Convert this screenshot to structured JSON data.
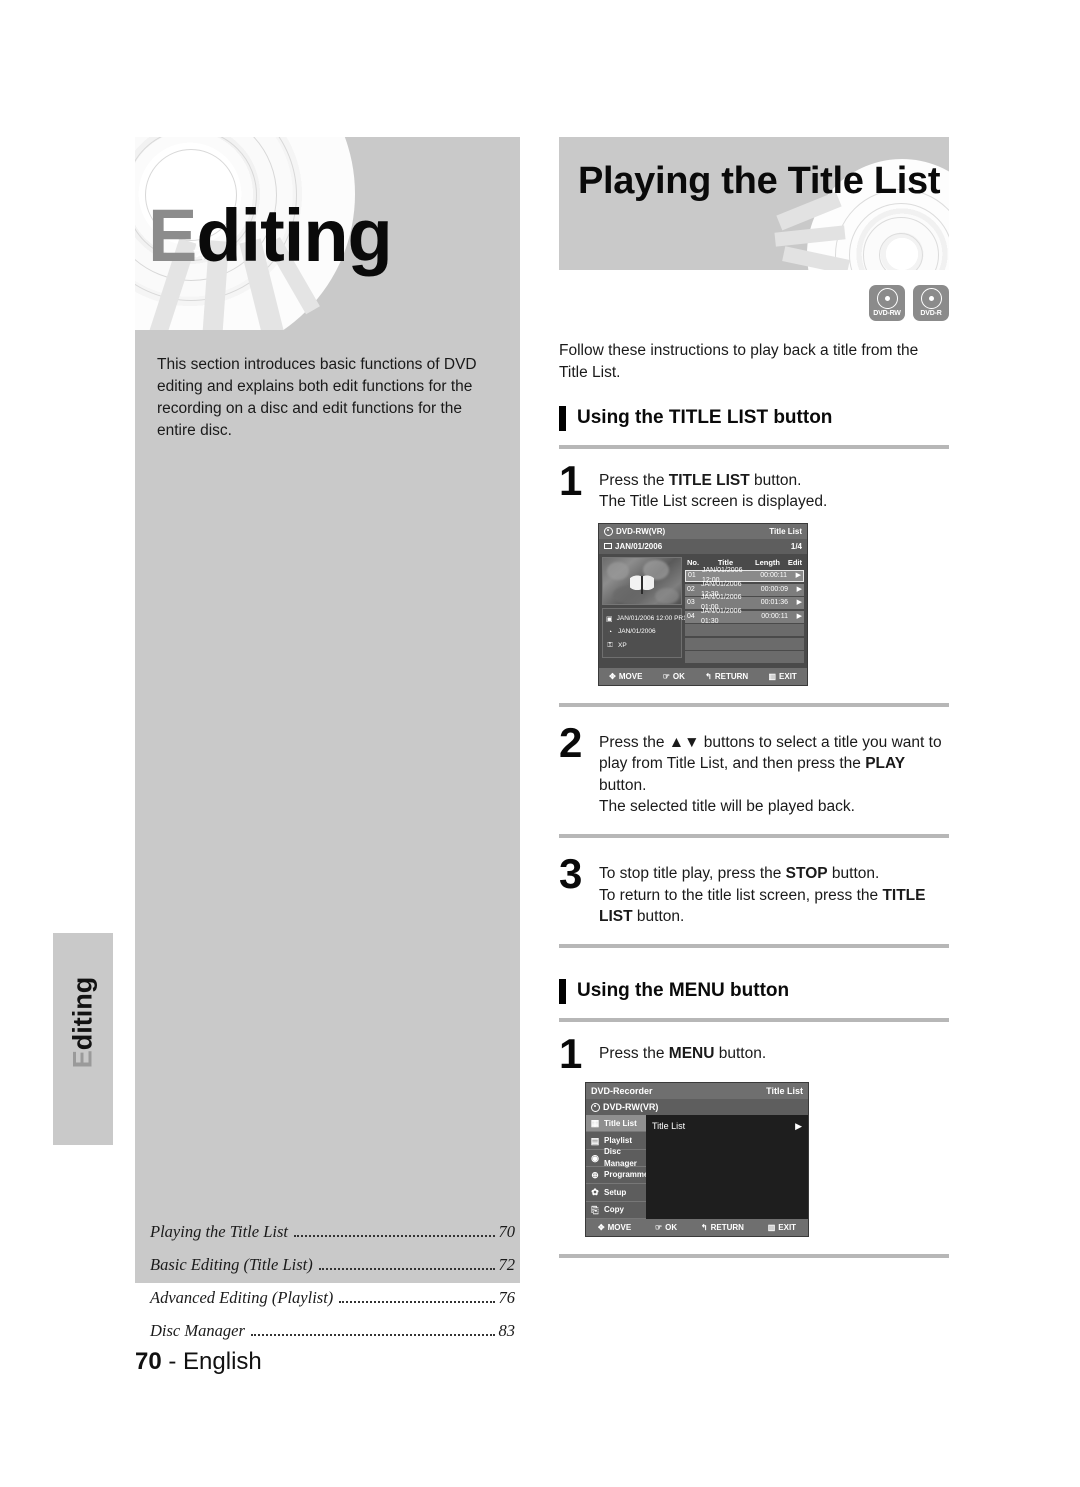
{
  "left": {
    "chapter_title_first": "E",
    "chapter_title_rest": "diting",
    "intro_paragraph": "This section introduces basic functions of DVD editing and explains both edit functions for the recording on a disc and edit functions for the entire disc.",
    "side_tab_first": "E",
    "side_tab_rest": "diting",
    "toc": [
      {
        "title": "Playing the Title List",
        "page": "70"
      },
      {
        "title": "Basic Editing (Title List)",
        "page": "72"
      },
      {
        "title": "Advanced Editing (Playlist)",
        "page": "76"
      },
      {
        "title": "Disc Manager",
        "page": "83"
      }
    ],
    "footer_page": "70",
    "footer_sep": "-",
    "footer_language": "English"
  },
  "right": {
    "section_title": "Playing the Title List",
    "badges": [
      {
        "label": "DVD-RW"
      },
      {
        "label": "DVD-R"
      }
    ],
    "lede": "Follow these instructions to play back a title from the Title List.",
    "subsection_1": {
      "heading": "Using the TITLE LIST button",
      "steps": [
        {
          "number": "1",
          "lines": [
            [
              {
                "t": "Press the ",
                "b": false
              },
              {
                "t": "TITLE LIST",
                "b": true
              },
              {
                "t": " button.",
                "b": false
              }
            ],
            [
              {
                "t": "The Title List screen is displayed.",
                "b": false
              }
            ]
          ]
        },
        {
          "number": "2",
          "lines": [
            [
              {
                "t": "Press the ▲▼ buttons to select a title you want to play from Title List, and then press the ",
                "b": false
              },
              {
                "t": "PLAY",
                "b": true
              },
              {
                "t": " button.",
                "b": false
              }
            ],
            [
              {
                "t": "The selected title will be played back.",
                "b": false
              }
            ]
          ]
        },
        {
          "number": "3",
          "lines": [
            [
              {
                "t": "To stop title play, press the ",
                "b": false
              },
              {
                "t": "STOP",
                "b": true
              },
              {
                "t": " button.",
                "b": false
              }
            ],
            [
              {
                "t": "To return to the title list screen, press the ",
                "b": false
              },
              {
                "t": "TITLE LIST",
                "b": true
              },
              {
                "t": " button.",
                "b": false
              }
            ]
          ]
        }
      ]
    },
    "subsection_2": {
      "heading": "Using the MENU button",
      "steps": [
        {
          "number": "1",
          "lines": [
            [
              {
                "t": "Press the ",
                "b": false
              },
              {
                "t": "MENU",
                "b": true
              },
              {
                "t": " button.",
                "b": false
              }
            ]
          ]
        }
      ]
    }
  },
  "osd_title_list": {
    "disc_type": "DVD-RW(VR)",
    "screen_name": "Title List",
    "disc_label": "JAN/01/2006",
    "page_indicator": "1/4",
    "columns": [
      "No.",
      "Title",
      "Length",
      "Edit"
    ],
    "rows": [
      {
        "no": "01",
        "title": "JAN/01/2006 12:00",
        "length": "00:00:11",
        "edit": "▶",
        "selected": true
      },
      {
        "no": "02",
        "title": "JAN/01/2006 12:30",
        "length": "00:00:09",
        "edit": "▶",
        "selected": false
      },
      {
        "no": "03",
        "title": "JAN/01/2006 01:00",
        "length": "00:01:36",
        "edit": "▶",
        "selected": false
      },
      {
        "no": "04",
        "title": "JAN/01/2006 01:30",
        "length": "00:00:11",
        "edit": "▶",
        "selected": false
      }
    ],
    "meta": [
      {
        "icon": "frame-icon",
        "glyph": "▣",
        "text": "JAN/01/2006 12:00 PR1"
      },
      {
        "icon": "clock-icon",
        "glyph": "◔",
        "text": "JAN/01/2006"
      },
      {
        "icon": "lock-icon",
        "glyph": "⚿",
        "text": "XP"
      }
    ],
    "footer": [
      {
        "icon": "dpad-icon",
        "glyph": "✥",
        "label": "MOVE"
      },
      {
        "icon": "ok-icon",
        "glyph": "☞",
        "label": "OK"
      },
      {
        "icon": "return-icon",
        "glyph": "↰",
        "label": "RETURN"
      },
      {
        "icon": "exit-icon",
        "glyph": "▥",
        "label": "EXIT"
      }
    ]
  },
  "osd_menu": {
    "device_name": "DVD-Recorder",
    "screen_name": "Title List",
    "disc_type": "DVD-RW(VR)",
    "side_items": [
      {
        "label": "Title List",
        "icon": "title-list-icon",
        "glyph": "▦",
        "active": true
      },
      {
        "label": "Playlist",
        "icon": "playlist-icon",
        "glyph": "▤",
        "active": false
      },
      {
        "label": "Disc Manager",
        "icon": "disc-manager-icon",
        "glyph": "◉",
        "active": false
      },
      {
        "label": "Programme",
        "icon": "programme-icon",
        "glyph": "⊕",
        "active": false
      },
      {
        "label": "Setup",
        "icon": "setup-icon",
        "glyph": "✿",
        "active": false
      },
      {
        "label": "Copy",
        "icon": "copy-icon",
        "glyph": "⎘",
        "active": false
      }
    ],
    "panel_row_label": "Title List",
    "panel_row_arrow": "▶",
    "footer": [
      {
        "icon": "dpad-icon",
        "glyph": "✥",
        "label": "MOVE"
      },
      {
        "icon": "ok-icon",
        "glyph": "☞",
        "label": "OK"
      },
      {
        "icon": "return-icon",
        "glyph": "↰",
        "label": "RETURN"
      },
      {
        "icon": "exit-icon",
        "glyph": "▥",
        "label": "EXIT"
      }
    ]
  },
  "colors": {
    "panel_gray": "#c9c9c9",
    "rule_gray": "#b7b7b7",
    "osd_bg": "#4a4a4a",
    "osd_bar": "#6f6f6f",
    "badge_gray": "#8b8b8b"
  }
}
